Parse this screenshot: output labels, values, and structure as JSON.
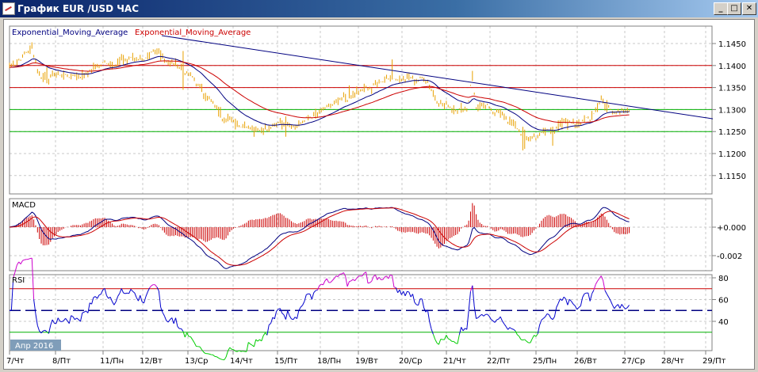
{
  "window": {
    "title": "График EUR /USD  ЧАС",
    "buttons": {
      "minimize": "_",
      "maximize": "□",
      "close": "✕"
    }
  },
  "legend": {
    "ema_fast": "Exponential_Moving_Average",
    "ema_slow": "Exponential_Moving_Average"
  },
  "colors": {
    "price": "#e8a000",
    "ema_fast": "#000080",
    "ema_slow": "#cc0000",
    "resistance": "#cc0000",
    "support": "#00b000",
    "trend": "#000080",
    "rsi": "#0000cc",
    "rsi_high": "#cc00cc",
    "rsi_low": "#00cc00"
  },
  "period_label": "Апр 2016",
  "chart_data": [
    {
      "type": "line",
      "title": "EUR/USD H1",
      "ylim": [
        1.11,
        1.148
      ],
      "yticks": [
        "1.1450",
        "1.1400",
        "1.1350",
        "1.1300",
        "1.1250",
        "1.1200",
        "1.1150"
      ],
      "ytick_values": [
        1.145,
        1.14,
        1.135,
        1.13,
        1.125,
        1.12,
        1.115
      ],
      "xticks": [
        "7/Чт",
        "8/Пт",
        "11/Пн",
        "12/Вт",
        "13/Ср",
        "14/Чт",
        "15/Пт",
        "18/Пн",
        "19/Вт",
        "20/Ср",
        "21/Чт",
        "22/Пт",
        "25/Пн",
        "26/Вт",
        "27/Ср",
        "28/Чт",
        "29/Пт"
      ],
      "price_keypoints_day_price": [
        [
          0,
          1.1396
        ],
        [
          0.5,
          1.1441
        ],
        [
          0.67,
          1.1378
        ],
        [
          1.56,
          1.1378
        ],
        [
          2.09,
          1.1405
        ],
        [
          2.62,
          1.1414
        ],
        [
          3.33,
          1.1423
        ],
        [
          3.86,
          1.1396
        ],
        [
          4.39,
          1.1333
        ],
        [
          4.74,
          1.1288
        ],
        [
          5.1,
          1.127
        ],
        [
          5.63,
          1.1261
        ],
        [
          6.34,
          1.127
        ],
        [
          6.87,
          1.1288
        ],
        [
          7.4,
          1.1315
        ],
        [
          8.1,
          1.1351
        ],
        [
          8.46,
          1.1378
        ],
        [
          9.0,
          1.1369
        ],
        [
          9.34,
          1.1369
        ],
        [
          9.52,
          1.1324
        ],
        [
          9.88,
          1.1306
        ],
        [
          10.23,
          1.1306
        ],
        [
          10.32,
          1.1387
        ],
        [
          10.41,
          1.1306
        ],
        [
          10.94,
          1.1297
        ],
        [
          11.29,
          1.1261
        ],
        [
          11.56,
          1.1229
        ],
        [
          12.0,
          1.1252
        ],
        [
          12.53,
          1.127
        ],
        [
          12.96,
          1.1279
        ],
        [
          13.2,
          1.1329
        ],
        [
          13.4,
          1.1301
        ],
        [
          13.85,
          1.1306
        ]
      ],
      "horizontal_lines": {
        "resistance": [
          1.14,
          1.135
        ],
        "support": [
          1.13,
          1.125
        ]
      },
      "trendline": [
        [
          3.4,
          1.1468
        ],
        [
          15.7,
          1.1279
        ]
      ]
    },
    {
      "type": "line",
      "title": "MACD",
      "ylim": [
        -0.003,
        0.002
      ],
      "yticks": [
        "+0.000",
        "-0.002"
      ],
      "ytick_values": [
        0,
        -0.002
      ]
    },
    {
      "type": "line",
      "title": "RSI",
      "ylim": [
        20,
        85
      ],
      "yticks": [
        "80",
        "60",
        "40"
      ],
      "ytick_values": [
        80,
        60,
        40
      ],
      "levels": [
        70,
        50,
        30
      ]
    }
  ]
}
